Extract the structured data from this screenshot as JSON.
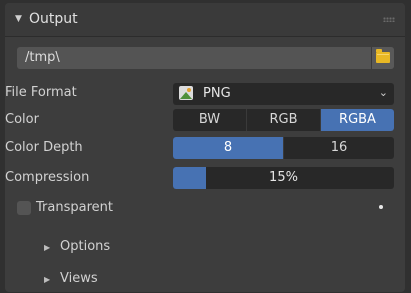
{
  "panel": {
    "title": "Output",
    "collapse_icon": "triangle-down-icon",
    "grip_icon": "drag-grip-icon"
  },
  "output_path": {
    "value": "/tmp\\",
    "browse_icon": "folder-icon"
  },
  "file_format": {
    "label": "File Format",
    "value": "PNG",
    "icon": "image-file-icon",
    "chevron": "⌄"
  },
  "color": {
    "label": "Color",
    "options": [
      "BW",
      "RGB",
      "RGBA"
    ],
    "selected": "RGBA"
  },
  "color_depth": {
    "label": "Color Depth",
    "options": [
      "8",
      "16"
    ],
    "selected": "8"
  },
  "compression": {
    "label": "Compression",
    "value_text": "15%",
    "value": 0.15
  },
  "transparent": {
    "label": "Transparent",
    "checked": false
  },
  "subpanels": [
    {
      "label": "Options",
      "icon": "triangle-right-icon"
    },
    {
      "label": "Views",
      "icon": "triangle-right-icon"
    }
  ],
  "colors": {
    "accent": "#4772b3",
    "panel_bg": "#3d3d3d",
    "field_bg": "#282828",
    "folder": "#e8b825"
  }
}
